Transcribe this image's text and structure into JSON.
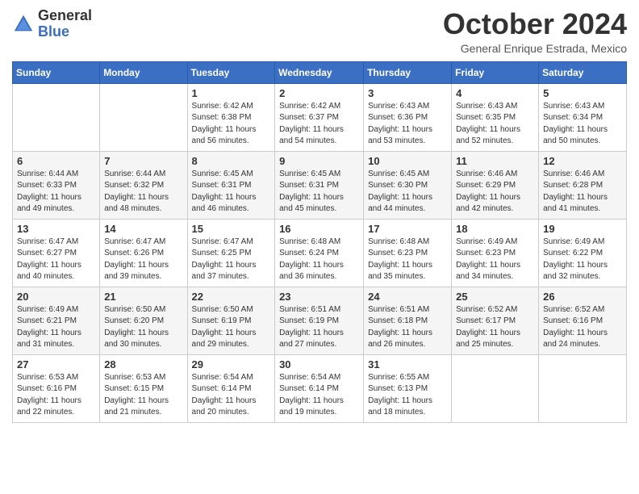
{
  "header": {
    "logo_general": "General",
    "logo_blue": "Blue",
    "month": "October 2024",
    "location": "General Enrique Estrada, Mexico"
  },
  "weekdays": [
    "Sunday",
    "Monday",
    "Tuesday",
    "Wednesday",
    "Thursday",
    "Friday",
    "Saturday"
  ],
  "weeks": [
    [
      {
        "day": "",
        "detail": ""
      },
      {
        "day": "",
        "detail": ""
      },
      {
        "day": "1",
        "detail": "Sunrise: 6:42 AM\nSunset: 6:38 PM\nDaylight: 11 hours and 56 minutes."
      },
      {
        "day": "2",
        "detail": "Sunrise: 6:42 AM\nSunset: 6:37 PM\nDaylight: 11 hours and 54 minutes."
      },
      {
        "day": "3",
        "detail": "Sunrise: 6:43 AM\nSunset: 6:36 PM\nDaylight: 11 hours and 53 minutes."
      },
      {
        "day": "4",
        "detail": "Sunrise: 6:43 AM\nSunset: 6:35 PM\nDaylight: 11 hours and 52 minutes."
      },
      {
        "day": "5",
        "detail": "Sunrise: 6:43 AM\nSunset: 6:34 PM\nDaylight: 11 hours and 50 minutes."
      }
    ],
    [
      {
        "day": "6",
        "detail": "Sunrise: 6:44 AM\nSunset: 6:33 PM\nDaylight: 11 hours and 49 minutes."
      },
      {
        "day": "7",
        "detail": "Sunrise: 6:44 AM\nSunset: 6:32 PM\nDaylight: 11 hours and 48 minutes."
      },
      {
        "day": "8",
        "detail": "Sunrise: 6:45 AM\nSunset: 6:31 PM\nDaylight: 11 hours and 46 minutes."
      },
      {
        "day": "9",
        "detail": "Sunrise: 6:45 AM\nSunset: 6:31 PM\nDaylight: 11 hours and 45 minutes."
      },
      {
        "day": "10",
        "detail": "Sunrise: 6:45 AM\nSunset: 6:30 PM\nDaylight: 11 hours and 44 minutes."
      },
      {
        "day": "11",
        "detail": "Sunrise: 6:46 AM\nSunset: 6:29 PM\nDaylight: 11 hours and 42 minutes."
      },
      {
        "day": "12",
        "detail": "Sunrise: 6:46 AM\nSunset: 6:28 PM\nDaylight: 11 hours and 41 minutes."
      }
    ],
    [
      {
        "day": "13",
        "detail": "Sunrise: 6:47 AM\nSunset: 6:27 PM\nDaylight: 11 hours and 40 minutes."
      },
      {
        "day": "14",
        "detail": "Sunrise: 6:47 AM\nSunset: 6:26 PM\nDaylight: 11 hours and 39 minutes."
      },
      {
        "day": "15",
        "detail": "Sunrise: 6:47 AM\nSunset: 6:25 PM\nDaylight: 11 hours and 37 minutes."
      },
      {
        "day": "16",
        "detail": "Sunrise: 6:48 AM\nSunset: 6:24 PM\nDaylight: 11 hours and 36 minutes."
      },
      {
        "day": "17",
        "detail": "Sunrise: 6:48 AM\nSunset: 6:23 PM\nDaylight: 11 hours and 35 minutes."
      },
      {
        "day": "18",
        "detail": "Sunrise: 6:49 AM\nSunset: 6:23 PM\nDaylight: 11 hours and 34 minutes."
      },
      {
        "day": "19",
        "detail": "Sunrise: 6:49 AM\nSunset: 6:22 PM\nDaylight: 11 hours and 32 minutes."
      }
    ],
    [
      {
        "day": "20",
        "detail": "Sunrise: 6:49 AM\nSunset: 6:21 PM\nDaylight: 11 hours and 31 minutes."
      },
      {
        "day": "21",
        "detail": "Sunrise: 6:50 AM\nSunset: 6:20 PM\nDaylight: 11 hours and 30 minutes."
      },
      {
        "day": "22",
        "detail": "Sunrise: 6:50 AM\nSunset: 6:19 PM\nDaylight: 11 hours and 29 minutes."
      },
      {
        "day": "23",
        "detail": "Sunrise: 6:51 AM\nSunset: 6:19 PM\nDaylight: 11 hours and 27 minutes."
      },
      {
        "day": "24",
        "detail": "Sunrise: 6:51 AM\nSunset: 6:18 PM\nDaylight: 11 hours and 26 minutes."
      },
      {
        "day": "25",
        "detail": "Sunrise: 6:52 AM\nSunset: 6:17 PM\nDaylight: 11 hours and 25 minutes."
      },
      {
        "day": "26",
        "detail": "Sunrise: 6:52 AM\nSunset: 6:16 PM\nDaylight: 11 hours and 24 minutes."
      }
    ],
    [
      {
        "day": "27",
        "detail": "Sunrise: 6:53 AM\nSunset: 6:16 PM\nDaylight: 11 hours and 22 minutes."
      },
      {
        "day": "28",
        "detail": "Sunrise: 6:53 AM\nSunset: 6:15 PM\nDaylight: 11 hours and 21 minutes."
      },
      {
        "day": "29",
        "detail": "Sunrise: 6:54 AM\nSunset: 6:14 PM\nDaylight: 11 hours and 20 minutes."
      },
      {
        "day": "30",
        "detail": "Sunrise: 6:54 AM\nSunset: 6:14 PM\nDaylight: 11 hours and 19 minutes."
      },
      {
        "day": "31",
        "detail": "Sunrise: 6:55 AM\nSunset: 6:13 PM\nDaylight: 11 hours and 18 minutes."
      },
      {
        "day": "",
        "detail": ""
      },
      {
        "day": "",
        "detail": ""
      }
    ]
  ]
}
